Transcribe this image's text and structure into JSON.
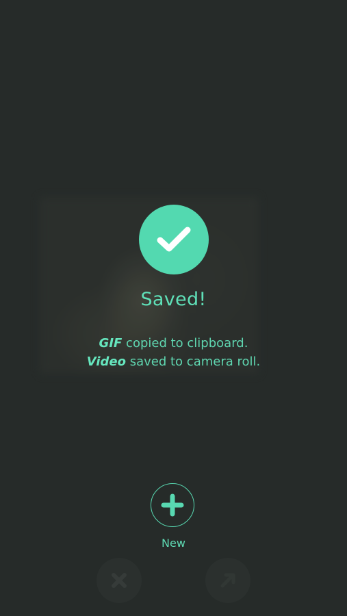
{
  "status": {
    "icon": "checkmark-icon",
    "title": "Saved!"
  },
  "messages": [
    {
      "emphasis": "GIF",
      "text": " copied to clipboard."
    },
    {
      "emphasis": "Video",
      "text": " saved to camera roll."
    }
  ],
  "actions": {
    "new_icon": "plus-icon",
    "new_label": "New",
    "close_icon": "close-icon",
    "share_icon": "share-icon"
  },
  "colors": {
    "background": "#262b29",
    "accent": "#53d9b0"
  }
}
